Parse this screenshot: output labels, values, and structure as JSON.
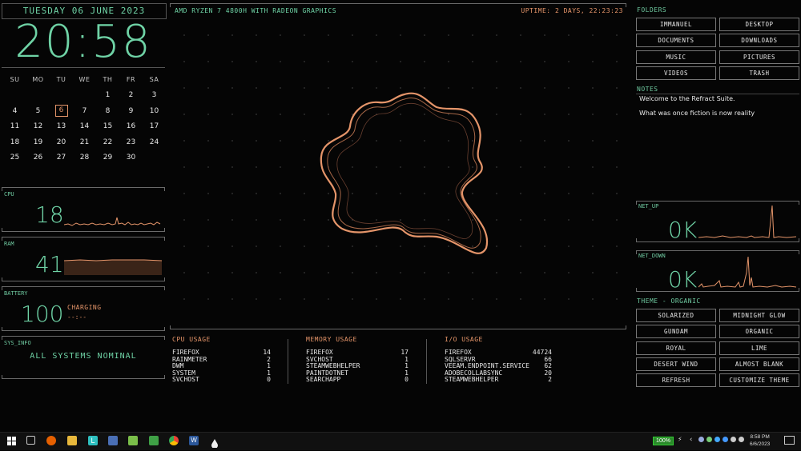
{
  "date": "TUESDAY 06 JUNE 2023",
  "clock": "20:58",
  "calendar": {
    "days": [
      "SU",
      "MO",
      "TU",
      "WE",
      "TH",
      "FR",
      "SA"
    ],
    "weeks": [
      [
        "",
        "",
        "",
        "",
        "1",
        "2",
        "3"
      ],
      [
        "4",
        "5",
        "6",
        "7",
        "8",
        "9",
        "10"
      ],
      [
        "11",
        "12",
        "13",
        "14",
        "15",
        "16",
        "17"
      ],
      [
        "18",
        "19",
        "20",
        "21",
        "22",
        "23",
        "24"
      ],
      [
        "25",
        "26",
        "27",
        "28",
        "29",
        "30",
        ""
      ]
    ],
    "today": "6"
  },
  "cpu": {
    "label": "CPU",
    "value": "18"
  },
  "ram": {
    "label": "RAM",
    "value": "41"
  },
  "battery": {
    "label": "BATTERY",
    "value": "100",
    "status": "CHARGING",
    "time": "--:--"
  },
  "sys_info": {
    "label": "SYS_INFO",
    "message": "ALL SYSTEMS NOMINAL"
  },
  "header": {
    "system_name": "AMD RYZEN 7 4800H WITH RADEON GRAPHICS",
    "uptime": "UPTIME: 2 DAYS, 22:23:23"
  },
  "cpu_usage": {
    "title": "CPU USAGE",
    "rows": [
      [
        "FIREFOX",
        "14"
      ],
      [
        "RAINMETER",
        "2"
      ],
      [
        "DWM",
        "1"
      ],
      [
        "SYSTEM",
        "1"
      ],
      [
        "SVCHOST",
        "0"
      ]
    ]
  },
  "memory_usage": {
    "title": "MEMORY USAGE",
    "rows": [
      [
        "FIREFOX",
        "17"
      ],
      [
        "SVCHOST",
        "1"
      ],
      [
        "STEAMWEBHELPER",
        "1"
      ],
      [
        "PAINTDOTNET",
        "1"
      ],
      [
        "SEARCHAPP",
        "0"
      ]
    ]
  },
  "io_usage": {
    "title": "I/O USAGE",
    "rows": [
      [
        "FIREFOX",
        "44724"
      ],
      [
        "SQLSERVR",
        "66"
      ],
      [
        "VEEAM.ENDPOINT.SERVICE",
        "62"
      ],
      [
        "ADOBECOLLABSYNC",
        "20"
      ],
      [
        "STEAMWEBHELPER",
        "2"
      ]
    ]
  },
  "folders": {
    "label": "FOLDERS",
    "items": [
      "IMMANUEL",
      "DESKTOP",
      "DOCUMENTS",
      "DOWNLOADS",
      "MUSIC",
      "PICTURES",
      "VIDEOS",
      "TRASH"
    ]
  },
  "notes": {
    "label": "NOTES",
    "lines": [
      "Welcome to the Refract Suite.",
      "What was once fiction is now reality"
    ]
  },
  "net_up": {
    "label": "NET_UP",
    "value": "0K"
  },
  "net_down": {
    "label": "NET_DOWN",
    "value": "0K"
  },
  "theme": {
    "label": "THEME - ORGANIC",
    "items": [
      "SOLARIZED",
      "MIDNIGHT GLOW",
      "GUNDAM",
      "ORGANIC",
      "ROYAL",
      "LIME",
      "DESERT WIND",
      "ALMOST BLANK",
      "REFRESH",
      "CUSTOMIZE THEME"
    ]
  },
  "taskbar": {
    "battery": "100%",
    "time": "8:58 PM",
    "date": "6/6/2023",
    "icons": [
      "start-icon",
      "task-view-icon",
      "firefox-icon",
      "file-explorer-icon",
      "lime-app-icon",
      "task-manager-icon",
      "media-icon",
      "android-studio-icon",
      "chrome-icon",
      "word-icon",
      "rainmeter-icon"
    ]
  },
  "colors": {
    "accent": "#6fd3a6",
    "highlight": "#e5956a",
    "background": "#050505"
  }
}
